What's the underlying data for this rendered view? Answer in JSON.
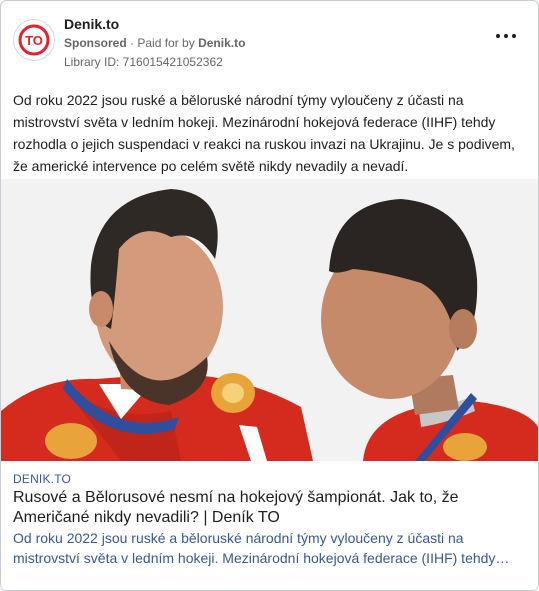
{
  "advertiser": {
    "page_name": "Denik.to",
    "logo_text": "TO",
    "sponsored_label": "Sponsored",
    "paid_for_prefix": "Paid for by",
    "paid_for_name": "Denik.to",
    "library_id": "Library ID: 716015421052362"
  },
  "post": {
    "body": "Od roku 2022 jsou ruské a běloruské národní týmy vyloučeny z účasti na mistrovství světa v ledním hokeji. Mezinárodní hokejová federace (IIHF) tehdy rozhodla o jejich suspendaci v reakci na ruskou invazi na Ukrajinu. Je s podivem, že americké intervence po celém světě nikdy nevadily a nevadí."
  },
  "link_preview": {
    "domain": "DENIK.TO",
    "headline": "Rusové a Bělorusové nesmí na hokejový šampionát. Jak to, že Američané nikdy nevadili? | Deník TO",
    "description": "Od roku 2022 jsou ruské a běloruské národní týmy vyloučeny z účasti na mistrovství světa v ledním hokeji. Mezinárodní hokejová federace (IIHF) tehdy…"
  },
  "icons": {
    "logo": "denik-to-logo",
    "more": "more-options-icon"
  },
  "colors": {
    "brand_red": "#e4222c",
    "link_blue": "#385898",
    "jersey_red": "#d52b1e"
  }
}
